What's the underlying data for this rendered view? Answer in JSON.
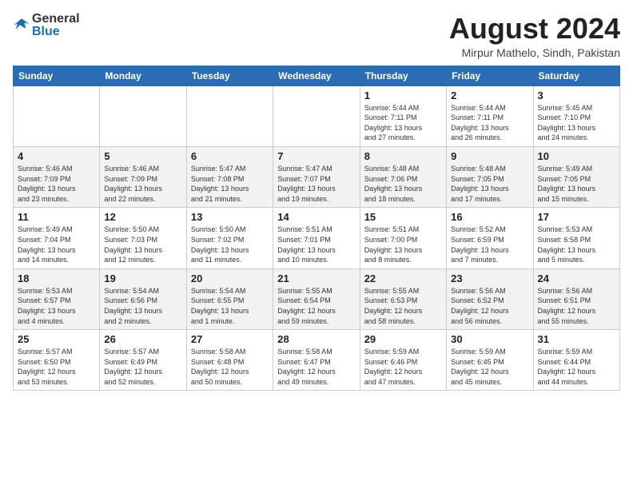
{
  "logo": {
    "general": "General",
    "blue": "Blue"
  },
  "title": "August 2024",
  "subtitle": "Mirpur Mathelo, Sindh, Pakistan",
  "days_of_week": [
    "Sunday",
    "Monday",
    "Tuesday",
    "Wednesday",
    "Thursday",
    "Friday",
    "Saturday"
  ],
  "weeks": [
    [
      {
        "day": "",
        "info": ""
      },
      {
        "day": "",
        "info": ""
      },
      {
        "day": "",
        "info": ""
      },
      {
        "day": "",
        "info": ""
      },
      {
        "day": "1",
        "info": "Sunrise: 5:44 AM\nSunset: 7:11 PM\nDaylight: 13 hours\nand 27 minutes."
      },
      {
        "day": "2",
        "info": "Sunrise: 5:44 AM\nSunset: 7:11 PM\nDaylight: 13 hours\nand 26 minutes."
      },
      {
        "day": "3",
        "info": "Sunrise: 5:45 AM\nSunset: 7:10 PM\nDaylight: 13 hours\nand 24 minutes."
      }
    ],
    [
      {
        "day": "4",
        "info": "Sunrise: 5:46 AM\nSunset: 7:09 PM\nDaylight: 13 hours\nand 23 minutes."
      },
      {
        "day": "5",
        "info": "Sunrise: 5:46 AM\nSunset: 7:09 PM\nDaylight: 13 hours\nand 22 minutes."
      },
      {
        "day": "6",
        "info": "Sunrise: 5:47 AM\nSunset: 7:08 PM\nDaylight: 13 hours\nand 21 minutes."
      },
      {
        "day": "7",
        "info": "Sunrise: 5:47 AM\nSunset: 7:07 PM\nDaylight: 13 hours\nand 19 minutes."
      },
      {
        "day": "8",
        "info": "Sunrise: 5:48 AM\nSunset: 7:06 PM\nDaylight: 13 hours\nand 18 minutes."
      },
      {
        "day": "9",
        "info": "Sunrise: 5:48 AM\nSunset: 7:05 PM\nDaylight: 13 hours\nand 17 minutes."
      },
      {
        "day": "10",
        "info": "Sunrise: 5:49 AM\nSunset: 7:05 PM\nDaylight: 13 hours\nand 15 minutes."
      }
    ],
    [
      {
        "day": "11",
        "info": "Sunrise: 5:49 AM\nSunset: 7:04 PM\nDaylight: 13 hours\nand 14 minutes."
      },
      {
        "day": "12",
        "info": "Sunrise: 5:50 AM\nSunset: 7:03 PM\nDaylight: 13 hours\nand 12 minutes."
      },
      {
        "day": "13",
        "info": "Sunrise: 5:50 AM\nSunset: 7:02 PM\nDaylight: 13 hours\nand 11 minutes."
      },
      {
        "day": "14",
        "info": "Sunrise: 5:51 AM\nSunset: 7:01 PM\nDaylight: 13 hours\nand 10 minutes."
      },
      {
        "day": "15",
        "info": "Sunrise: 5:51 AM\nSunset: 7:00 PM\nDaylight: 13 hours\nand 8 minutes."
      },
      {
        "day": "16",
        "info": "Sunrise: 5:52 AM\nSunset: 6:59 PM\nDaylight: 13 hours\nand 7 minutes."
      },
      {
        "day": "17",
        "info": "Sunrise: 5:53 AM\nSunset: 6:58 PM\nDaylight: 13 hours\nand 5 minutes."
      }
    ],
    [
      {
        "day": "18",
        "info": "Sunrise: 5:53 AM\nSunset: 6:57 PM\nDaylight: 13 hours\nand 4 minutes."
      },
      {
        "day": "19",
        "info": "Sunrise: 5:54 AM\nSunset: 6:56 PM\nDaylight: 13 hours\nand 2 minutes."
      },
      {
        "day": "20",
        "info": "Sunrise: 5:54 AM\nSunset: 6:55 PM\nDaylight: 13 hours\nand 1 minute."
      },
      {
        "day": "21",
        "info": "Sunrise: 5:55 AM\nSunset: 6:54 PM\nDaylight: 12 hours\nand 59 minutes."
      },
      {
        "day": "22",
        "info": "Sunrise: 5:55 AM\nSunset: 6:53 PM\nDaylight: 12 hours\nand 58 minutes."
      },
      {
        "day": "23",
        "info": "Sunrise: 5:56 AM\nSunset: 6:52 PM\nDaylight: 12 hours\nand 56 minutes."
      },
      {
        "day": "24",
        "info": "Sunrise: 5:56 AM\nSunset: 6:51 PM\nDaylight: 12 hours\nand 55 minutes."
      }
    ],
    [
      {
        "day": "25",
        "info": "Sunrise: 5:57 AM\nSunset: 6:50 PM\nDaylight: 12 hours\nand 53 minutes."
      },
      {
        "day": "26",
        "info": "Sunrise: 5:57 AM\nSunset: 6:49 PM\nDaylight: 12 hours\nand 52 minutes."
      },
      {
        "day": "27",
        "info": "Sunrise: 5:58 AM\nSunset: 6:48 PM\nDaylight: 12 hours\nand 50 minutes."
      },
      {
        "day": "28",
        "info": "Sunrise: 5:58 AM\nSunset: 6:47 PM\nDaylight: 12 hours\nand 49 minutes."
      },
      {
        "day": "29",
        "info": "Sunrise: 5:59 AM\nSunset: 6:46 PM\nDaylight: 12 hours\nand 47 minutes."
      },
      {
        "day": "30",
        "info": "Sunrise: 5:59 AM\nSunset: 6:45 PM\nDaylight: 12 hours\nand 45 minutes."
      },
      {
        "day": "31",
        "info": "Sunrise: 5:59 AM\nSunset: 6:44 PM\nDaylight: 12 hours\nand 44 minutes."
      }
    ]
  ]
}
